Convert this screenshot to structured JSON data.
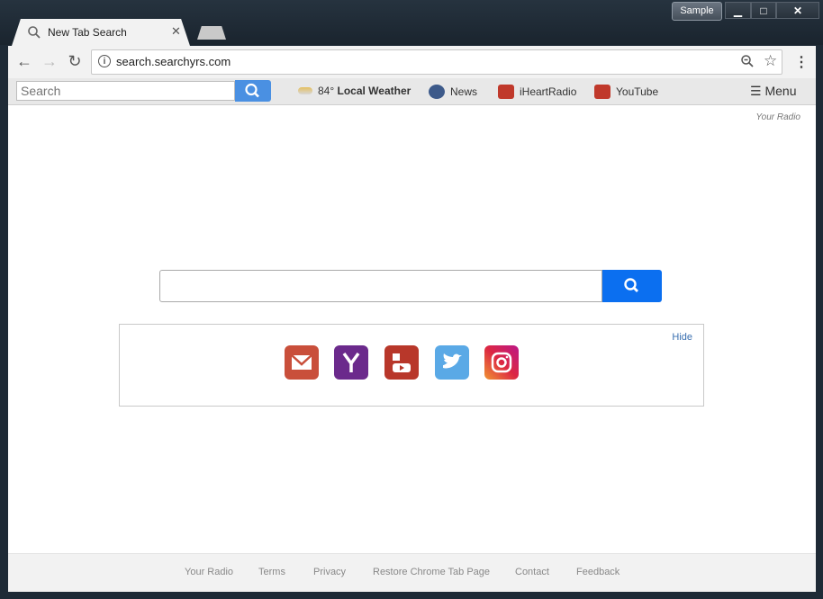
{
  "window": {
    "profile": "Sample",
    "controls": {
      "minimize": "▁",
      "maximize": "□",
      "close": "✕"
    }
  },
  "tab": {
    "title": "New Tab Search",
    "icon": "search-icon",
    "close": "✕"
  },
  "address_bar": {
    "url": "search.searchyrs.com",
    "info": "i"
  },
  "extension_bar": {
    "search_placeholder": "Search",
    "weather": {
      "temp": "84°",
      "label": "Local Weather"
    },
    "links": [
      {
        "label": "News",
        "color": "#3d5a8a"
      },
      {
        "label": "iHeartRadio",
        "color": "#c0392b"
      },
      {
        "label": "YouTube",
        "color": "#c0392b"
      }
    ],
    "menu_label": "Menu"
  },
  "page": {
    "your_radio": "Your Radio",
    "search_value": "",
    "hide_label": "Hide",
    "tiles": [
      {
        "name": "gmail",
        "color": "#c94f3b"
      },
      {
        "name": "yahoo",
        "color": "#6b2a8c"
      },
      {
        "name": "youtube",
        "color": "#b8372a"
      },
      {
        "name": "twitter",
        "color": "#5aa9e6"
      },
      {
        "name": "instagram",
        "color": "#c7376b"
      }
    ]
  },
  "footer": [
    "Your Radio",
    "Terms",
    "Privacy",
    "Restore Chrome Tab Page",
    "Contact",
    "Feedback"
  ]
}
